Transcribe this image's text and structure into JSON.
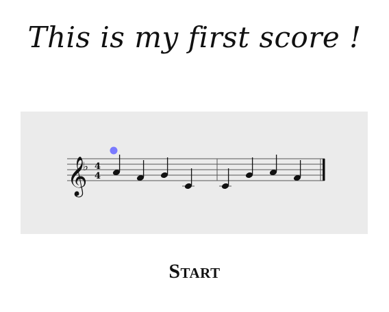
{
  "page": {
    "title": "This is my first score !",
    "start_label": "Start"
  },
  "score": {
    "clef": "treble-clef-icon",
    "key_signature": "♭",
    "time_signature": {
      "top": "4",
      "bottom": "4"
    },
    "measures": [
      {
        "notes": [
          {
            "pitch": "A4",
            "duration": "quarter"
          },
          {
            "pitch": "F4",
            "duration": "quarter"
          },
          {
            "pitch": "G4",
            "duration": "quarter"
          },
          {
            "pitch": "C4",
            "duration": "quarter"
          }
        ]
      },
      {
        "notes": [
          {
            "pitch": "C4",
            "duration": "quarter"
          },
          {
            "pitch": "G4",
            "duration": "quarter"
          },
          {
            "pitch": "A4",
            "duration": "quarter"
          },
          {
            "pitch": "F4",
            "duration": "quarter"
          }
        ]
      }
    ],
    "cursor_note_index": 0,
    "colors": {
      "panel": "#ebebeb",
      "cursor": "#7a7aff",
      "ink": "#111111"
    }
  }
}
